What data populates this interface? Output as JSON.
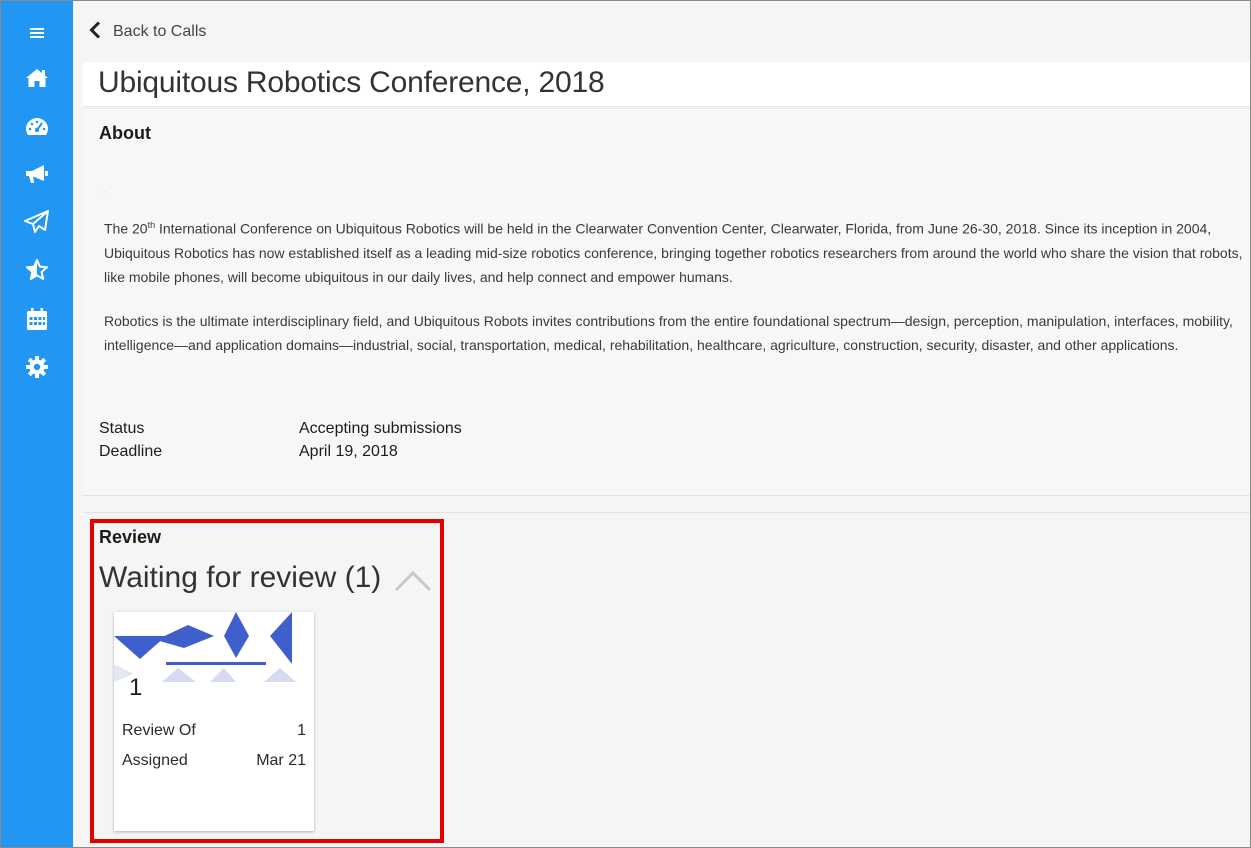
{
  "colors": {
    "sidebar": "#2196f3",
    "highlight": "#e50000",
    "art": "#3f5fcc"
  },
  "sidebar": {
    "items": [
      {
        "icon": "menu-icon"
      },
      {
        "icon": "home-icon"
      },
      {
        "icon": "dashboard-icon"
      },
      {
        "icon": "megaphone-icon"
      },
      {
        "icon": "send-icon"
      },
      {
        "icon": "star-icon"
      },
      {
        "icon": "calendar-icon"
      },
      {
        "icon": "gear-icon"
      }
    ]
  },
  "nav": {
    "back_label": "Back to Calls"
  },
  "page": {
    "title": "Ubiquitous Robotics Conference, 2018"
  },
  "about": {
    "heading": "About",
    "p1_before_sup": "The 20",
    "p1_sup": "th",
    "p1_after_sup": " International Conference on Ubiquitous Robotics will be held in the Clearwater Convention Center, Clearwater, Florida, from June 26-30, 2018. Since its inception in 2004, Ubiquitous Robotics has now established itself as a leading mid-size robotics conference, bringing together robotics researchers from around the world who share the vision that robots, like mobile phones, will become ubiquitous in our daily lives, and help connect and empower humans.",
    "p2": "Robotics is the ultimate interdisciplinary field, and Ubiquitous Robots invites contributions from the entire foundational spectrum—design, perception, manipulation, interfaces, mobility, intelligence—and application domains—industrial, social, transportation, medical, rehabilitation, healthcare, agriculture, construction, security, disaster, and other applications.",
    "status_label": "Status",
    "status_value": "Accepting submissions",
    "deadline_label": "Deadline",
    "deadline_value": "April 19, 2018"
  },
  "review": {
    "heading": "Review",
    "waiting_label": "Waiting for review (1)",
    "card": {
      "number": "1",
      "review_of_label": "Review Of",
      "review_of_value": "1",
      "assigned_label": "Assigned",
      "assigned_value": "Mar 21"
    }
  }
}
